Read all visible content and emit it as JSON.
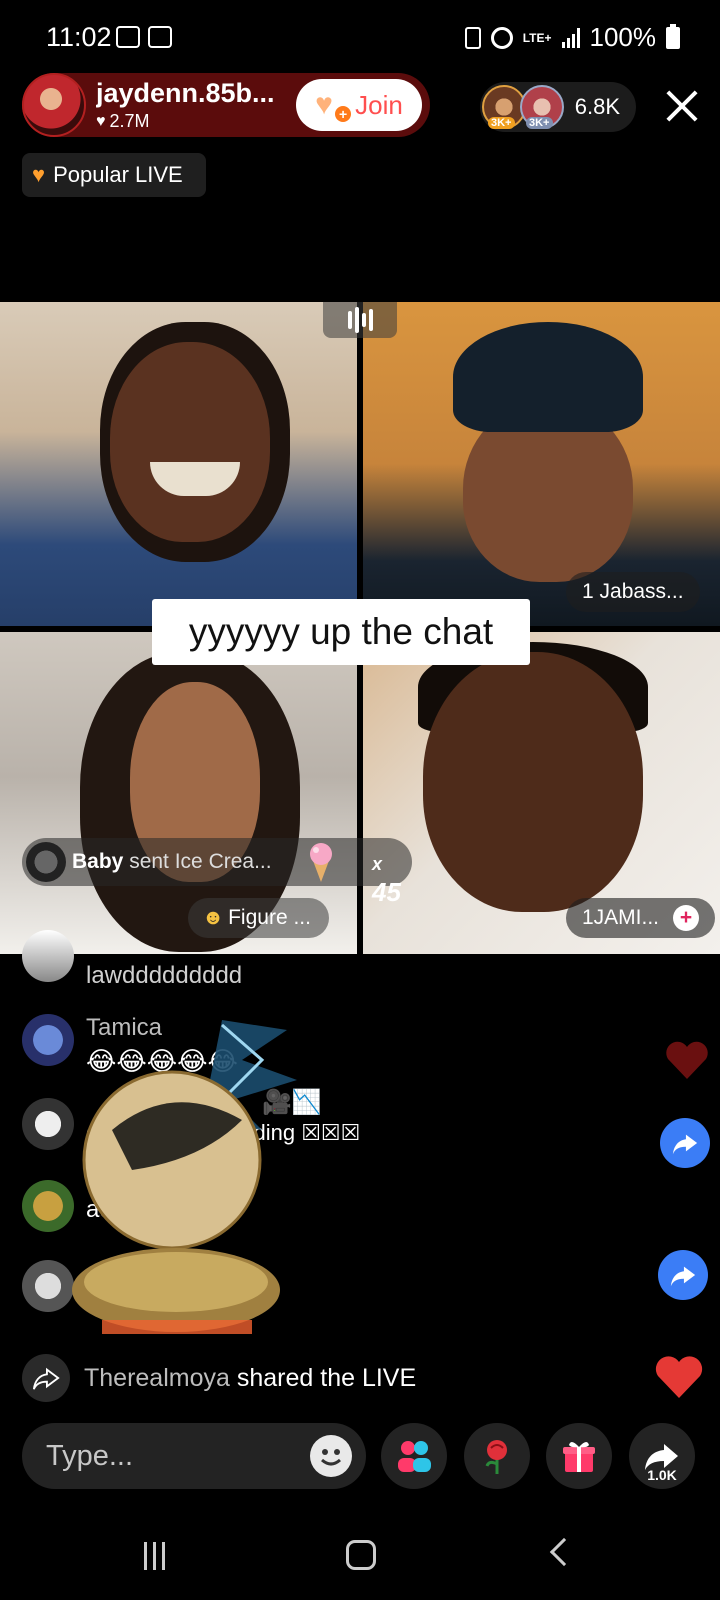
{
  "status_bar": {
    "time": "11:02",
    "network": "LTE+",
    "battery": "100%",
    "icons": [
      "screen-record-icon",
      "screenshot-icon",
      "nfc-icon",
      "alarm-icon",
      "signal-icon",
      "battery-icon"
    ]
  },
  "host": {
    "name": "jaydenn.85b...",
    "likes": "2.7M",
    "join_label": "Join"
  },
  "viewers": {
    "badges": [
      "3K+",
      "3K+"
    ],
    "count": "6.8K"
  },
  "popular_label": "Popular LIVE",
  "grid": {
    "cells": [
      {
        "label": ""
      },
      {
        "label": "1 Jabass..."
      },
      {
        "label": ""
      },
      {
        "label": "1JAMI..."
      }
    ],
    "caption": "yyyyyy up the chat"
  },
  "gift_banner": {
    "sender": "Baby",
    "text": " sent Ice Crea...",
    "multiplier_x": "x",
    "multiplier_count": "45"
  },
  "figure_label": "Figure  ...",
  "chat": [
    {
      "user": "",
      "line": "lawddddddddd"
    },
    {
      "user": "Tamica",
      "line": "😂😂😂😂😂"
    },
    {
      "user": "",
      "line": "🎥📉"
    },
    {
      "user": "",
      "line": "darkside litter cording ☒☒☒"
    },
    {
      "user": "",
      "line": "au"
    },
    {
      "user": "",
      "line": "😊😊"
    }
  ],
  "shared": {
    "user": "Therealmoya",
    "text": "shared the LIVE"
  },
  "bottom_bar": {
    "input_placeholder": "Type...",
    "share_count": "1.0K"
  },
  "colors": {
    "host_pill": "#5b0c0c",
    "join_text": "#ff4f4f",
    "share_button": "#3b7df6",
    "heart": "#e53935",
    "gift_box": "#ff3a6a"
  }
}
